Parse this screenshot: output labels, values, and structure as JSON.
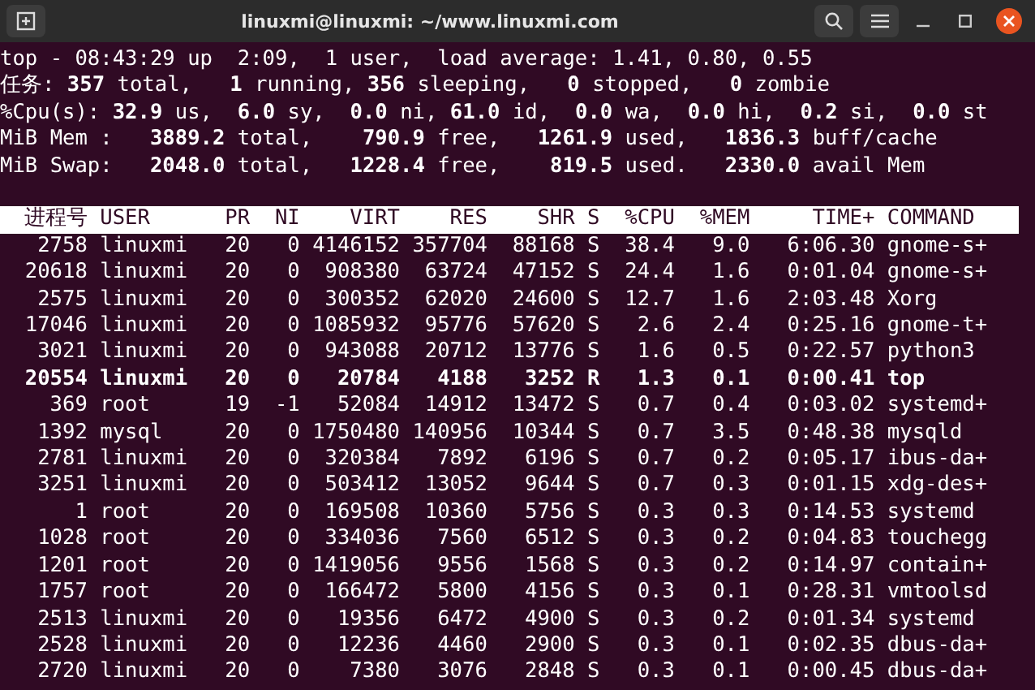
{
  "window": {
    "title": "linuxmi@linuxmi: ~/www.linuxmi.com"
  },
  "summary_lines": [
    "top - 08:43:29 up  2:09,  1 user,  load average: 1.41, 0.80, 0.55",
    "任务: **357** total,   **1** running, **356** sleeping,   **0** stopped,   **0** zombie",
    "%Cpu(s): **32.9** us,  **6.0** sy,  **0.0** ni, **61.0** id,  **0.0** wa,  **0.0** hi,  **0.2** si,  **0.0** st",
    "MiB Mem :   **3889.2** total,    **790.9** free,   **1261.9** used,   **1836.3** buff/cache",
    "MiB Swap:   **2048.0** total,   **1228.4** free,    **819.5** used.   **2330.0** avail Mem"
  ],
  "table": {
    "columns": [
      "进程号",
      "USER",
      "PR",
      "NI",
      "VIRT",
      "RES",
      "SHR",
      "S",
      "%CPU",
      "%MEM",
      "TIME+",
      "COMMAND"
    ],
    "rows": [
      {
        "cells": [
          "2758",
          "linuxmi",
          "20",
          "0",
          "4146152",
          "357704",
          "88168",
          "S",
          "38.4",
          "9.0",
          "6:06.30",
          "gnome-s+"
        ],
        "highlighted": false
      },
      {
        "cells": [
          "20618",
          "linuxmi",
          "20",
          "0",
          "908380",
          "63724",
          "47152",
          "S",
          "24.4",
          "1.6",
          "0:01.04",
          "gnome-s+"
        ],
        "highlighted": false
      },
      {
        "cells": [
          "2575",
          "linuxmi",
          "20",
          "0",
          "300352",
          "62020",
          "24600",
          "S",
          "12.7",
          "1.6",
          "2:03.48",
          "Xorg"
        ],
        "highlighted": false
      },
      {
        "cells": [
          "17046",
          "linuxmi",
          "20",
          "0",
          "1085932",
          "95776",
          "57620",
          "S",
          "2.6",
          "2.4",
          "0:25.16",
          "gnome-t+"
        ],
        "highlighted": false
      },
      {
        "cells": [
          "3021",
          "linuxmi",
          "20",
          "0",
          "943088",
          "20712",
          "13776",
          "S",
          "1.6",
          "0.5",
          "0:22.57",
          "python3"
        ],
        "highlighted": false
      },
      {
        "cells": [
          "20554",
          "linuxmi",
          "20",
          "0",
          "20784",
          "4188",
          "3252",
          "R",
          "1.3",
          "0.1",
          "0:00.41",
          "top"
        ],
        "highlighted": true
      },
      {
        "cells": [
          "369",
          "root",
          "19",
          "-1",
          "52084",
          "14912",
          "13472",
          "S",
          "0.7",
          "0.4",
          "0:03.02",
          "systemd+"
        ],
        "highlighted": false
      },
      {
        "cells": [
          "1392",
          "mysql",
          "20",
          "0",
          "1750480",
          "140956",
          "10344",
          "S",
          "0.7",
          "3.5",
          "0:48.38",
          "mysqld"
        ],
        "highlighted": false
      },
      {
        "cells": [
          "2781",
          "linuxmi",
          "20",
          "0",
          "320384",
          "7892",
          "6196",
          "S",
          "0.7",
          "0.2",
          "0:05.17",
          "ibus-da+"
        ],
        "highlighted": false
      },
      {
        "cells": [
          "3251",
          "linuxmi",
          "20",
          "0",
          "503412",
          "13052",
          "9644",
          "S",
          "0.7",
          "0.3",
          "0:01.15",
          "xdg-des+"
        ],
        "highlighted": false
      },
      {
        "cells": [
          "1",
          "root",
          "20",
          "0",
          "169508",
          "10360",
          "5756",
          "S",
          "0.3",
          "0.3",
          "0:14.53",
          "systemd"
        ],
        "highlighted": false
      },
      {
        "cells": [
          "1028",
          "root",
          "20",
          "0",
          "334036",
          "7560",
          "6512",
          "S",
          "0.3",
          "0.2",
          "0:04.83",
          "touchegg"
        ],
        "highlighted": false
      },
      {
        "cells": [
          "1201",
          "root",
          "20",
          "0",
          "1419056",
          "9556",
          "1568",
          "S",
          "0.3",
          "0.2",
          "0:14.97",
          "contain+"
        ],
        "highlighted": false
      },
      {
        "cells": [
          "1757",
          "root",
          "20",
          "0",
          "166472",
          "5800",
          "4156",
          "S",
          "0.3",
          "0.1",
          "0:28.31",
          "vmtoolsd"
        ],
        "highlighted": false
      },
      {
        "cells": [
          "2513",
          "linuxmi",
          "20",
          "0",
          "19356",
          "6472",
          "4900",
          "S",
          "0.3",
          "0.2",
          "0:01.34",
          "systemd"
        ],
        "highlighted": false
      },
      {
        "cells": [
          "2528",
          "linuxmi",
          "20",
          "0",
          "12236",
          "4460",
          "2900",
          "S",
          "0.3",
          "0.1",
          "0:02.35",
          "dbus-da+"
        ],
        "highlighted": false
      },
      {
        "cells": [
          "2720",
          "linuxmi",
          "20",
          "0",
          "7380",
          "3076",
          "2848",
          "S",
          "0.3",
          "0.1",
          "0:00.45",
          "dbus-da+"
        ],
        "highlighted": false
      }
    ]
  }
}
